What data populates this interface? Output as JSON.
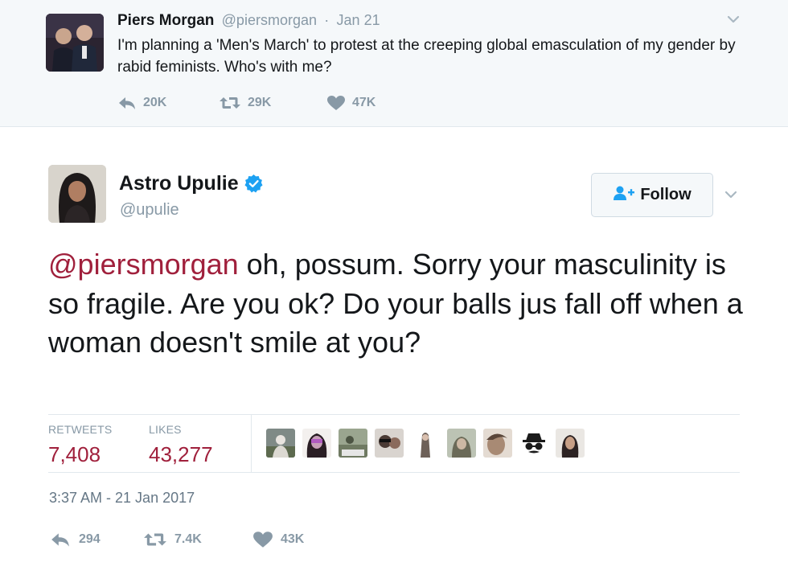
{
  "parent_tweet": {
    "name": "Piers Morgan",
    "handle": "@piersmorgan",
    "separator": "·",
    "date": "Jan 21",
    "text": "I'm planning a 'Men's March' to protest at the creeping global emasculation of my gender by rabid feminists. Who's with me?",
    "replies": "20K",
    "retweets": "29K",
    "likes": "47K"
  },
  "tweet": {
    "name": "Astro Upulie",
    "handle": "@upulie",
    "follow_label": "Follow",
    "mention": "@piersmorgan",
    "text": " oh, possum. Sorry your masculinity is so fragile. Are you ok? Do your balls jus fall off when a woman doesn't smile at you?",
    "retweets_label": "RETWEETS",
    "retweets_count": "7,408",
    "likes_label": "LIKES",
    "likes_count": "43,277",
    "timestamp": "3:37 AM - 21 Jan 2017",
    "reply_count": "294",
    "retweet_short": "7.4K",
    "like_short": "43K"
  },
  "colors": {
    "accent": "#a0203c",
    "muted": "#8899a6",
    "verified": "#1da1f2",
    "follow_icon": "#1da1f2"
  },
  "icons": [
    "reply-icon",
    "retweet-icon",
    "heart-icon",
    "verified-badge-icon",
    "follow-user-icon",
    "chevron-down-icon"
  ]
}
